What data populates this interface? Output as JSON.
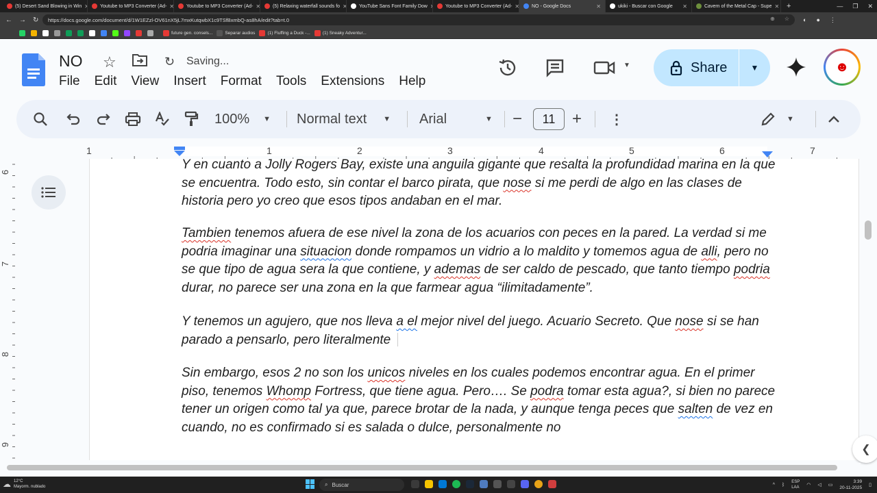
{
  "browser": {
    "tabs": [
      {
        "label": "(5) Desert Sand Blowing in Win",
        "favicon": "#e53935"
      },
      {
        "label": "Youtube to MP3 Converter (Ad-",
        "favicon": "#e53935"
      },
      {
        "label": "Youtube to MP3 Converter (Ad-",
        "favicon": "#e53935"
      },
      {
        "label": "(5) Relaxing waterfall sounds fo",
        "favicon": "#e53935"
      },
      {
        "label": "YouTube Sans Font Family Dow",
        "favicon": "#ffffff"
      },
      {
        "label": "Youtube to MP3 Converter (Ad-",
        "favicon": "#e53935"
      },
      {
        "label": "NO - Google Docs",
        "favicon": "#4285f4"
      },
      {
        "label": "ukiki - Buscar con Google",
        "favicon": "#ffffff"
      },
      {
        "label": "Cavern of the Metal Cap - Supe",
        "favicon": "#6d8f3c"
      }
    ],
    "url": "https://docs.google.com/document/d/1W1EZzl-OV61nX5jL7mxKutqwbX1c9TSfBxmbQ-as8hA/edit?tab=t.0",
    "bookmarks": [
      {
        "label": "future gen. consels...",
        "color": "#e53935"
      },
      {
        "label": "Separar audios",
        "color": "#555555"
      },
      {
        "label": "(1) Fluffing a Duck -...",
        "color": "#e53935"
      },
      {
        "label": "(1) Sneaky Adventur...",
        "color": "#e53935"
      }
    ]
  },
  "docs": {
    "title": "NO",
    "save_status": "Saving...",
    "menu": [
      "File",
      "Edit",
      "View",
      "Insert",
      "Format",
      "Tools",
      "Extensions",
      "Help"
    ],
    "share_label": "Share",
    "toolbar": {
      "zoom": "100%",
      "style": "Normal text",
      "font": "Arial",
      "font_size": "11"
    },
    "ruler_numbers": [
      "1",
      "1",
      "2",
      "3",
      "4",
      "5",
      "6",
      "7"
    ],
    "vruler_numbers": [
      "6",
      "7",
      "8",
      "9"
    ],
    "paragraphs": [
      [
        {
          "t": "Y en cuanto a Jolly Rogers Bay, existe una anguila gigante que resalta la profundidad marina en la que se encuentra. Todo esto, sin contar el barco pirata, que "
        },
        {
          "t": "nose",
          "s": "sq"
        },
        {
          "t": " si me perdi de algo en las clases de historia pero yo creo que esos tipos andaban en el mar."
        }
      ],
      [
        {
          "t": "Tambien",
          "s": "sq"
        },
        {
          "t": " tenemos afuera de ese nivel la zona de los acuarios con peces en la pared. La verdad si me podria imaginar una "
        },
        {
          "t": "situacion",
          "s": "bq"
        },
        {
          "t": " donde rompamos un vidrio a lo maldito y tomemos agua de "
        },
        {
          "t": "alli",
          "s": "sq"
        },
        {
          "t": ", pero no se que tipo de agua sera la que contiene, y "
        },
        {
          "t": "ademas",
          "s": "sq"
        },
        {
          "t": " de ser caldo de pescado, que tanto tiempo "
        },
        {
          "t": "podria",
          "s": "sq"
        },
        {
          "t": " durar, no parece ser una zona en la que farmear agua “ilimitadamente”."
        }
      ],
      [
        {
          "t": "Y tenemos un agujero, que nos lleva "
        },
        {
          "t": "a el",
          "s": "bq"
        },
        {
          "t": " mejor nivel del juego. Acuario Secreto. Que "
        },
        {
          "t": "nose",
          "s": "sq"
        },
        {
          "t": " si se han parado a pensarlo, pero literalmente "
        }
      ],
      [
        {
          "t": "Sin embargo, esos 2 no son los "
        },
        {
          "t": "unicos",
          "s": "sq"
        },
        {
          "t": " niveles en los cuales podemos encontrar agua. En el primer piso, tenemos "
        },
        {
          "t": "Whomp",
          "s": "sq"
        },
        {
          "t": " Fortress, que tiene agua. Pero…. Se "
        },
        {
          "t": "podra",
          "s": "sq"
        },
        {
          "t": " tomar esta agua?, si bien no parece tener un origen como tal ya que, parece brotar de la nada, y aunque tenga peces que "
        },
        {
          "t": "salten",
          "s": "bq"
        },
        {
          "t": " de vez en cuando, no es confirmado si es salada o dulce, personalmente no"
        }
      ]
    ]
  },
  "taskbar": {
    "weather_temp": "12°C",
    "weather_desc": "Mayorm. nublado",
    "search_placeholder": "Buscar",
    "lang": "ESP",
    "lang2": "LAA",
    "time": "3:39",
    "date": "20-11-2025"
  }
}
